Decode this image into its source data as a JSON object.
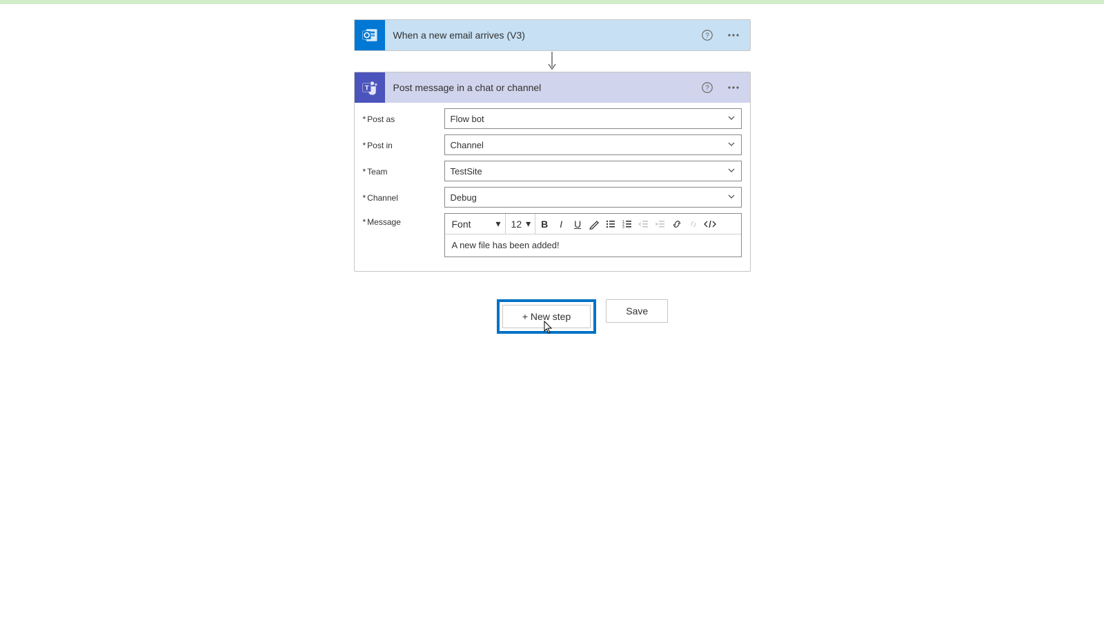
{
  "trigger": {
    "title": "When a new email arrives (V3)"
  },
  "action": {
    "title": "Post message in a chat or channel",
    "fields": {
      "post_as": {
        "label": "Post as",
        "value": "Flow bot"
      },
      "post_in": {
        "label": "Post in",
        "value": "Channel"
      },
      "team": {
        "label": "Team",
        "value": "TestSite"
      },
      "channel": {
        "label": "Channel",
        "value": "Debug"
      },
      "message": {
        "label": "Message",
        "body": "A new file has been added!"
      }
    },
    "rte": {
      "font": "Font",
      "size": "12"
    }
  },
  "buttons": {
    "new_step": "+ New step",
    "save": "Save"
  }
}
